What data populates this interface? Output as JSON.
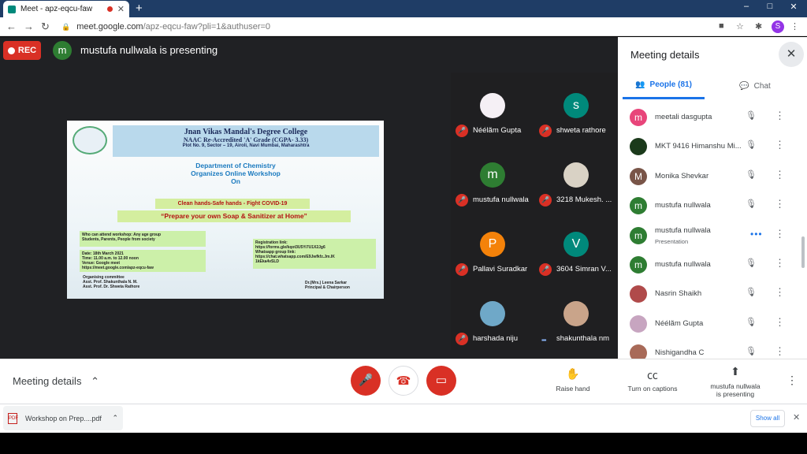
{
  "browser": {
    "tab_title": "Meet - apz-eqcu-faw",
    "new_tab_icon": "+",
    "url_domain": "meet.google.com",
    "url_path": "/apz-eqcu-faw?pli=1&authuser=0",
    "profile_initial": "S",
    "window_controls": [
      "–",
      "□",
      "✕"
    ]
  },
  "meet": {
    "rec_label": "REC",
    "presenter_initial": "m",
    "presenter_label": "mustufa nullwala is presenting"
  },
  "slide": {
    "college": "Jnan Vikas Mandal's Degree College",
    "accreditation": "NAAC Re-Accredited 'A' Grade (CGPA- 3.33)",
    "address": "Plot No. 9, Sector – 19, Airoli, Navi Mumbai, Maharashtra",
    "dept_line1": "Department of Chemistry",
    "dept_line2": "Organizes Online Workshop",
    "dept_line3": "On",
    "clean": "Clean hands-Safe hands - Fight COVID-19",
    "prepare": "“Prepare your own Soap & Sanitizer at Home”",
    "who1": "Who can attend workshop: Any age group",
    "who2": "Students, Parents, People from society",
    "date1": "Date: 18th March 2021",
    "date2": "Time: 11.00 a.m. to 12.00 noon",
    "date3": "Venue: Google meet",
    "date4": "https://meet.google.com/apz-eqcu-faw",
    "reg1": "Registration link:",
    "reg2": "https://forms.gle/kqot3U5Yi7U1X2Jg6",
    "reg3": "Whatsapp group link:",
    "reg4": "https://chat.whatsapp.com/E9Jwfkfz.Jm.IK",
    "reg5": "1kEka4vSLD",
    "org1": "Organising committee",
    "org2": "Asst. Prof. Shakunthala N. M.",
    "org3": "Asst. Prof. Dr. Shweta Rathore",
    "sig1": "Dr.(Mrs.) Leena Sarkar",
    "sig2": "Principal & Chairperson"
  },
  "tiles": [
    {
      "name": "Néélãm Gupta",
      "initial": "",
      "color": "#f5f0f5",
      "muted": true
    },
    {
      "name": "shweta rathore",
      "initial": "s",
      "color": "#00897b",
      "muted": true
    },
    {
      "name": "mustufa nullwala",
      "initial": "m",
      "color": "#2e7d32",
      "muted": true
    },
    {
      "name": "3218 Mukesh. ...",
      "initial": "",
      "color": "#d9d2c5",
      "muted": true
    },
    {
      "name": "Pallavi Suradkar",
      "initial": "P",
      "color": "#f4820a",
      "muted": true
    },
    {
      "name": "3604 Simran V...",
      "initial": "V",
      "color": "#00897b",
      "muted": true
    },
    {
      "name": "harshada niju",
      "initial": "",
      "color": "#6fa8c8",
      "muted": true
    },
    {
      "name": "shakunthala nm",
      "initial": "",
      "color": "#c9a48a",
      "muted": false
    }
  ],
  "panel": {
    "title": "Meeting details",
    "people_tab": "People (81)",
    "chat_tab": "Chat",
    "participants": [
      {
        "name": "meetali dasgupta",
        "sub": "",
        "initial": "m",
        "color": "#e8457a",
        "state": "muted"
      },
      {
        "name": "MKT 9416 Himanshu Mi...",
        "sub": "",
        "initial": "",
        "color": "#1b3a1b",
        "state": "muted"
      },
      {
        "name": "Monika Shevkar",
        "sub": "",
        "initial": "M",
        "color": "#795548",
        "state": "muted"
      },
      {
        "name": "mustufa nullwala",
        "sub": "",
        "initial": "m",
        "color": "#2e7d32",
        "state": "muted"
      },
      {
        "name": "mustufa nullwala",
        "sub": "Presentation",
        "initial": "m",
        "color": "#2e7d32",
        "state": "presenting"
      },
      {
        "name": "mustufa nullwala",
        "sub": "",
        "initial": "m",
        "color": "#2e7d32",
        "state": "muted"
      },
      {
        "name": "Nasrin Shaikh",
        "sub": "",
        "initial": "",
        "color": "#b04a4a",
        "state": "muted"
      },
      {
        "name": "Néélãm Gupta",
        "sub": "",
        "initial": "",
        "color": "#c7a5c0",
        "state": "muted"
      },
      {
        "name": "Nishigandha C",
        "sub": "",
        "initial": "",
        "color": "#a86a58",
        "state": "muted"
      }
    ]
  },
  "bottom": {
    "meeting_details": "Meeting details",
    "raise_hand": "Raise hand",
    "captions": "Turn on captions",
    "presenting_line1": "mustufa nullwala",
    "presenting_line2": "is presenting"
  },
  "downloads": {
    "file": "Workshop on Prep....pdf",
    "file_type": "PDF",
    "show_all": "Show all"
  }
}
